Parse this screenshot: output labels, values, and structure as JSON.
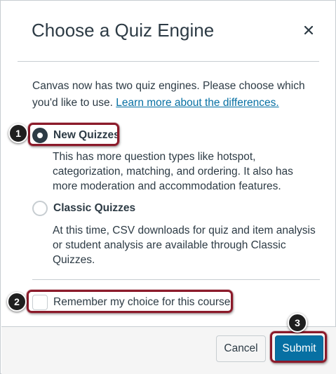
{
  "dialog": {
    "title": "Choose a Quiz Engine",
    "close_glyph": "×"
  },
  "intro": {
    "text": "Canvas now has two quiz engines. Please choose which you'd like to use.",
    "link": "Learn more about the differences."
  },
  "options": [
    {
      "label": "New Quizzes",
      "selected": true,
      "description": "This has more question types like hotspot, categorization, matching, and ordering. It also has more moderation and accommodation features."
    },
    {
      "label": "Classic Quizzes",
      "selected": false,
      "description": "At this time, CSV downloads for quiz and item analysis or student analysis are available through Classic Quizzes."
    }
  ],
  "remember": {
    "label": "Remember my choice for this course",
    "checked": false
  },
  "footer": {
    "cancel_label": "Cancel",
    "submit_label": "Submit"
  },
  "callouts": [
    "1",
    "2",
    "3"
  ],
  "colors": {
    "accent": "#0770a3",
    "text": "#2d3b45",
    "highlight": "#8b1a2a",
    "border": "#c7cdd1"
  }
}
